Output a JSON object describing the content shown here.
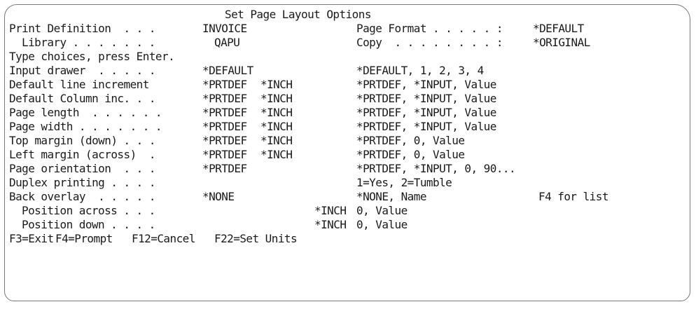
{
  "screen": {
    "title": "Set Page Layout Options",
    "header": {
      "print_definition_label": "Print Definition  . . .",
      "print_definition_value": "INVOICE",
      "page_format_label": "Page Format . . . . . :",
      "page_format_value": "*DEFAULT",
      "library_label": "Library . . . . . . .",
      "library_value": "QAPU",
      "copy_label": "Copy  . . . . . . . . :",
      "copy_value": "*ORIGINAL"
    },
    "instruction": "Type choices, press Enter.",
    "fields": [
      {
        "label": "Input drawer  . . . . .",
        "value": "*DEFAULT",
        "unit": "",
        "hint": "*DEFAULT, 1, 2, 3, 4"
      },
      {
        "label": "Default line increment",
        "value": "*PRTDEF",
        "unit": "*INCH",
        "hint": "*PRTDEF, *INPUT, Value"
      },
      {
        "label": "Default Column inc. . .",
        "value": "*PRTDEF",
        "unit": "*INCH",
        "hint": "*PRTDEF, *INPUT, Value"
      },
      {
        "label": "Page length  . . . . . .",
        "value": "*PRTDEF",
        "unit": "*INCH",
        "hint": "*PRTDEF, *INPUT, Value"
      },
      {
        "label": "Page width . . . . . . .",
        "value": "*PRTDEF",
        "unit": "*INCH",
        "hint": "*PRTDEF, *INPUT, Value"
      },
      {
        "label": "Top margin (down) . . .",
        "value": "*PRTDEF",
        "unit": "*INCH",
        "hint": "*PRTDEF, 0, Value"
      },
      {
        "label": "Left margin (across)  .",
        "value": "*PRTDEF",
        "unit": "*INCH",
        "hint": "*PRTDEF, 0, Value"
      },
      {
        "label": "Page orientation  . . .",
        "value": "*PRTDEF",
        "unit": "",
        "hint": "*PRTDEF, *INPUT, 0, 90..."
      },
      {
        "label": "Duplex printing . . . .",
        "value": "",
        "unit": "",
        "hint": "1=Yes, 2=Tumble"
      },
      {
        "label": "Back overlay  . . . . .",
        "value": "*NONE",
        "unit": "",
        "hint": "*NONE, Name",
        "hint2": "F4 for list"
      }
    ],
    "position_fields": [
      {
        "label": "Position across . . .",
        "unit": "*INCH",
        "hint": "0, Value"
      },
      {
        "label": "Position down . . . .",
        "unit": "*INCH",
        "hint": "0, Value"
      }
    ],
    "function_keys": [
      "F3=Exit",
      "F4=Prompt",
      "F12=Cancel",
      "F22=Set Units"
    ]
  }
}
